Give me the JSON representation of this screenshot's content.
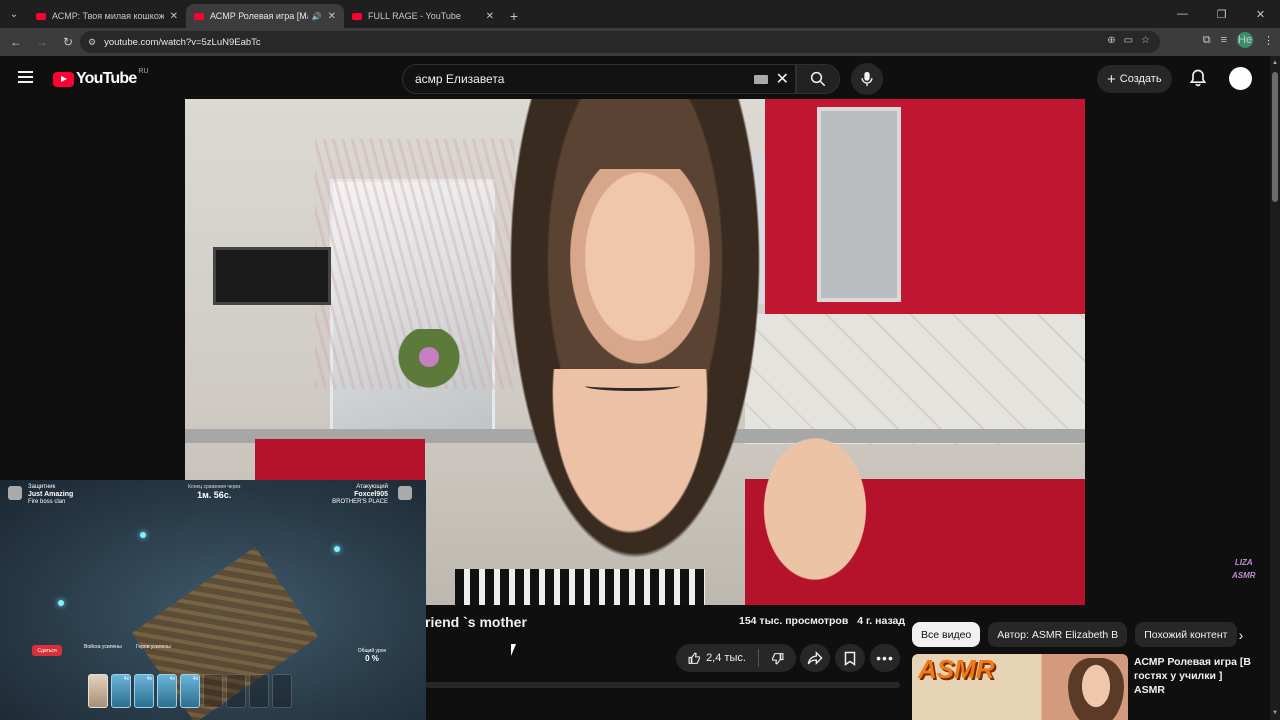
{
  "browser": {
    "tabs": [
      {
        "title": "АСМР: Твоя милая кошкожена",
        "active": false
      },
      {
        "title": "АСМР Ролевая игра [Мама",
        "active": true
      },
      {
        "title": "FULL RAGE - YouTube",
        "active": false
      }
    ],
    "url": "youtube.com/watch?v=5zLuN9EabTc",
    "profile_label": "Не"
  },
  "youtube": {
    "logo_text": "YouTube",
    "region": "RU",
    "search_query": "асмр Елизавета",
    "create_label": "Создать"
  },
  "video": {
    "title_visible": "riend `s mother",
    "views": "154 тыс. просмотров",
    "age": "4 г. назад",
    "likes": "2,4 тыс.",
    "watermark_line1": "LIZA",
    "watermark_line2": "ASMR"
  },
  "related": {
    "chips": [
      "Все видео",
      "Автор: ASMR Elizabeth B",
      "Похожий контент"
    ],
    "first_video_title": "АСМР Ролевая игра [В гостях у училки ] ASMR",
    "first_video_thumb_text": "ASMR"
  },
  "pip_game": {
    "left_role": "Защитник",
    "left_player": "Just Amazing",
    "left_clan": "Fire boss clan",
    "timer_label": "Конец сражения через",
    "timer": "1м. 56с.",
    "right_role": "Атакующий",
    "right_player": "Foxcel905",
    "right_clan": "BROTHER'S PLACE",
    "surrender": "Сдаться",
    "troops_label": "Войска усилены",
    "heroes_label": "Герои усилены",
    "damage_label": "Общий урон",
    "damage_value": "0 %",
    "card_counts": [
      "",
      "4x",
      "4x",
      "4x",
      "4x",
      "",
      "",
      "",
      ""
    ]
  },
  "colors": {
    "yt_red": "#ff0033",
    "bg": "#0f0f0f",
    "chip_bg": "#272727"
  }
}
